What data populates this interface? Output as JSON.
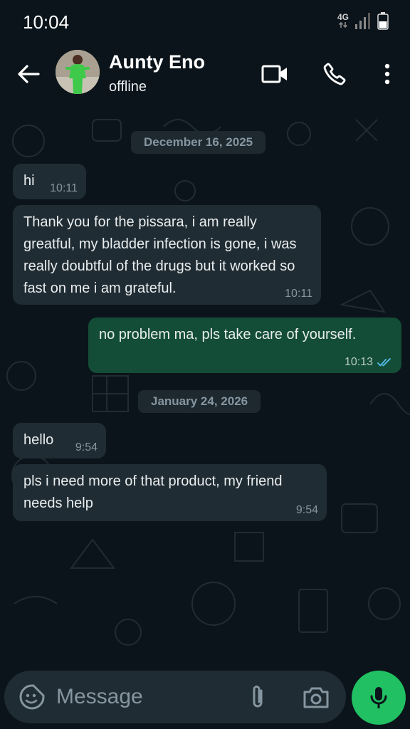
{
  "status_bar": {
    "time": "10:04",
    "network": "4G"
  },
  "header": {
    "contact_name": "Aunty Eno",
    "contact_status": "offline",
    "icons": [
      "back-arrow-icon",
      "video-call-icon",
      "voice-call-icon",
      "more-options-icon"
    ]
  },
  "chat": {
    "date_separators": [
      "December 16, 2025",
      "January 24, 2026"
    ],
    "messages": [
      {
        "direction": "incoming",
        "text": "hi",
        "time": "10:11"
      },
      {
        "direction": "incoming",
        "text": "Thank you for the pissara, i am really greatful, my bladder infection is gone, i was really doubtful of the drugs but it worked so fast on me i am grateful.",
        "time": "10:11"
      },
      {
        "direction": "outgoing",
        "text": "no problem ma, pls take care of yourself.",
        "time": "10:13",
        "read": true
      },
      {
        "direction": "incoming",
        "text": "hello",
        "time": "9:54"
      },
      {
        "direction": "incoming",
        "text": "pls i need more of that product, my friend needs help",
        "time": "9:54"
      }
    ]
  },
  "input": {
    "placeholder": "Message"
  },
  "colors": {
    "background": "#0b141a",
    "incoming_bubble": "#202c33",
    "outgoing_bubble": "#144d37",
    "accent": "#21c063",
    "read_receipt": "#53bdeb"
  }
}
